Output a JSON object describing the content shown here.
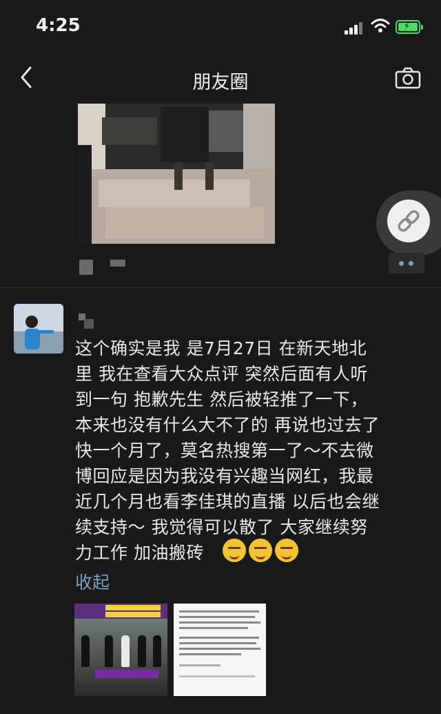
{
  "status_bar": {
    "time": "4:25"
  },
  "nav": {
    "title": "朋友圈"
  },
  "post": {
    "text": "这个确实是我 是7月27日 在新天地北\n里 我在查看大众点评 突然后面有人听\n到一句 抱歉先生 然后被轻推了一下，\n本来也没有什么大不了的 再说也过去了\n快一个月了，莫名热搜第一了～不去微\n博回应是因为我没有兴趣当网红，我最\n近几个月也看李佳琪的直播 以后也会继\n续支持～ 我觉得可以散了 大家继续努\n力工作 加油搬砖",
    "emoji_count": 3,
    "collapse_label": "收起",
    "images": [
      "news-screenshot-thumbnail",
      "text-screenshot-thumbnail"
    ]
  },
  "icons": [
    "back-chevron",
    "camera",
    "link",
    "more-dots",
    "signal",
    "wifi",
    "battery-charging"
  ],
  "colors": {
    "background": "#191919",
    "link": "#7d9fc2",
    "battery": "#4cd964"
  }
}
